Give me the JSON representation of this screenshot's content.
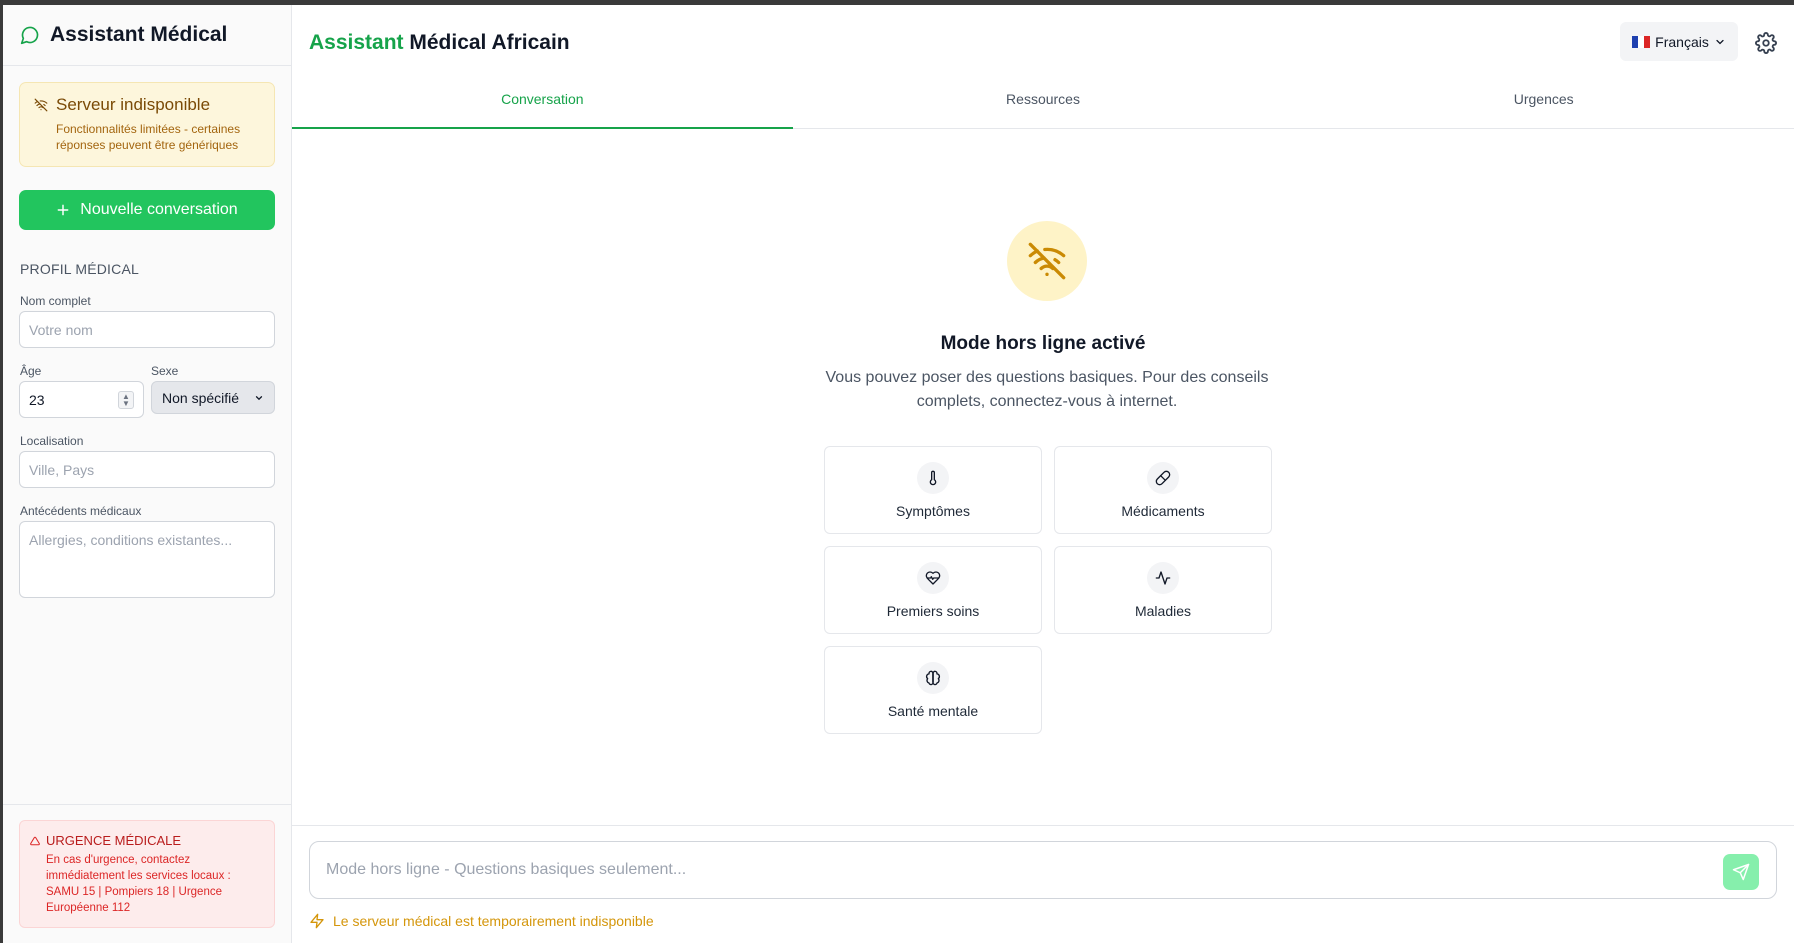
{
  "sidebar": {
    "brand": "Assistant Médical",
    "warning": {
      "title": "Serveur indisponible",
      "description": "Fonctionnalités limitées - certaines réponses peuvent être génériques"
    },
    "new_conversation": "Nouvelle conversation",
    "profile": {
      "section_title": "PROFIL MÉDICAL",
      "name_label": "Nom complet",
      "name_placeholder": "Votre nom",
      "age_label": "Âge",
      "age_value": "23",
      "sex_label": "Sexe",
      "sex_value": "Non spécifié",
      "location_label": "Localisation",
      "location_placeholder": "Ville, Pays",
      "history_label": "Antécédents médicaux",
      "history_placeholder": "Allergies, conditions existantes..."
    },
    "emergency": {
      "title": "URGENCE MÉDICALE",
      "text": "En cas d'urgence, contactez immédiatement les services locaux : SAMU 15 | Pompiers 18 | Urgence Européenne 112"
    }
  },
  "header": {
    "title_accent": "Assistant",
    "title_rest": " Médical Africain",
    "language": "Français"
  },
  "tabs": [
    {
      "label": "Conversation",
      "active": true
    },
    {
      "label": "Ressources",
      "active": false
    },
    {
      "label": "Urgences",
      "active": false
    }
  ],
  "offline": {
    "title": "Mode hors ligne activé",
    "description": "Vous pouvez poser des questions basiques. Pour des conseils complets, connectez-vous à internet."
  },
  "categories": [
    {
      "label": "Symptômes",
      "icon": "thermometer-icon"
    },
    {
      "label": "Médicaments",
      "icon": "pill-icon"
    },
    {
      "label": "Premiers soins",
      "icon": "heart-pulse-icon"
    },
    {
      "label": "Maladies",
      "icon": "activity-icon"
    },
    {
      "label": "Santé mentale",
      "icon": "brain-icon"
    }
  ],
  "composer": {
    "placeholder": "Mode hors ligne - Questions basiques seulement...",
    "status": "Le serveur médical est temporairement indisponible"
  },
  "colors": {
    "accent_green": "#16a34a",
    "button_green": "#22c55e",
    "warning_bg": "#fdf6dc",
    "warning_text": "#7a4a06",
    "emergency_bg": "#fdecec",
    "emergency_text": "#dc2626",
    "status_amber": "#d4960b"
  }
}
